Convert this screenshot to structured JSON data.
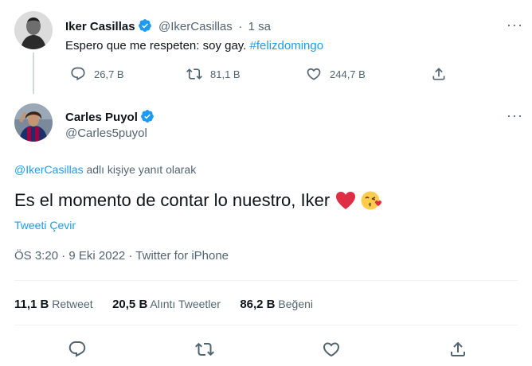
{
  "original_tweet": {
    "display_name": "Iker Casillas",
    "handle": "@IkerCasillas",
    "time": "1 sa",
    "separator": "·",
    "text_plain": "Espero que me respeten: soy gay. ",
    "hashtag": "#felizdomingo",
    "replies": "26,7 B",
    "retweets": "81,1 B",
    "likes": "244,7 B"
  },
  "reply_tweet": {
    "display_name": "Carles Puyol",
    "handle": "@Carles5puyol",
    "reply_to_handle": "@IkerCasillas",
    "reply_to_suffix": " adlı kişiye yanıt olarak",
    "text": "Es el momento de contar lo nuestro, Iker",
    "emoji_heart": "❤️",
    "emoji_kiss": "😘",
    "translate_label": "Tweeti Çevir",
    "timestamp": "ÖS 3:20 · 9 Eki 2022 · Twitter for iPhone"
  },
  "stats": {
    "retweets_count": "11,1 B",
    "retweets_label": "Retweet",
    "quotes_count": "20,5 B",
    "quotes_label": "Alıntı Tweetler",
    "likes_count": "86,2 B",
    "likes_label": "Beğeni"
  },
  "more_glyph": "···",
  "colors": {
    "accent": "#1d9bf0",
    "text": "#0f1419",
    "muted": "#536471",
    "divider": "#eff3f4",
    "heart": "#e0245e"
  }
}
